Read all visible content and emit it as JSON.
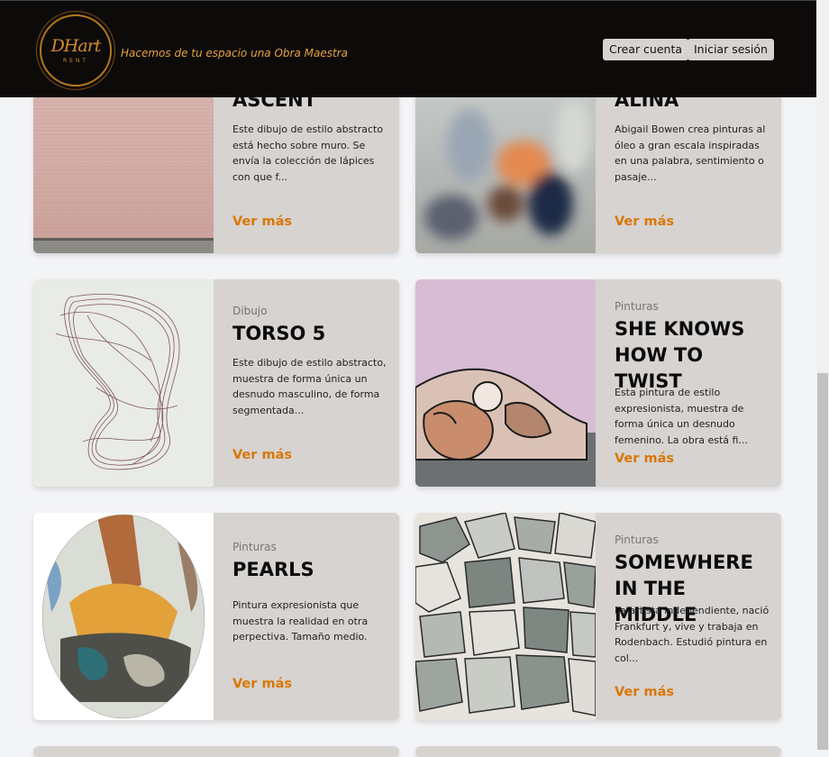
{
  "header": {
    "logo_text": "DHart",
    "logo_sub": "RENT",
    "slogan": "Hacemos de tu espacio una Obra Maestra",
    "create_account": "Crear cuenta",
    "login": "Iniciar sesión"
  },
  "cards": [
    {
      "category": "",
      "title": "ASCENT",
      "description": "Este dibujo de estilo abstracto está hecho sobre muro. Se envía la colección de lápices con que f...",
      "link": "Ver más"
    },
    {
      "category": "",
      "title": "ALINA",
      "description": "Abigail Bowen crea pinturas al óleo a gran escala inspiradas en una palabra, sentimiento o pasaje...",
      "link": "Ver más"
    },
    {
      "category": "Dibujo",
      "title": "TORSO 5",
      "description": "Este dibujo de estilo abstracto, muestra de forma única un desnudo masculino, de forma segmentada...",
      "link": "Ver más"
    },
    {
      "category": "Pinturas",
      "title": "SHE KNOWS HOW TO TWIST",
      "description": "Esta pintura de estilo expresionista, muestra de forma única un desnudo femenino. La obra está fi...",
      "link": "Ver más"
    },
    {
      "category": "Pinturas",
      "title": "PEARLS",
      "description": "Pintura expresionista que muestra la realidad en otra perpectiva. Tamaño medio.",
      "link": "Ver más"
    },
    {
      "category": "Pinturas",
      "title": "SOMEWHERE IN THE MIDDLE",
      "description": "La artista independiente, nació Frankfurt y, vive y trabaja en Rodenbach. Estudió pintura en col...",
      "link": "Ver más"
    }
  ]
}
